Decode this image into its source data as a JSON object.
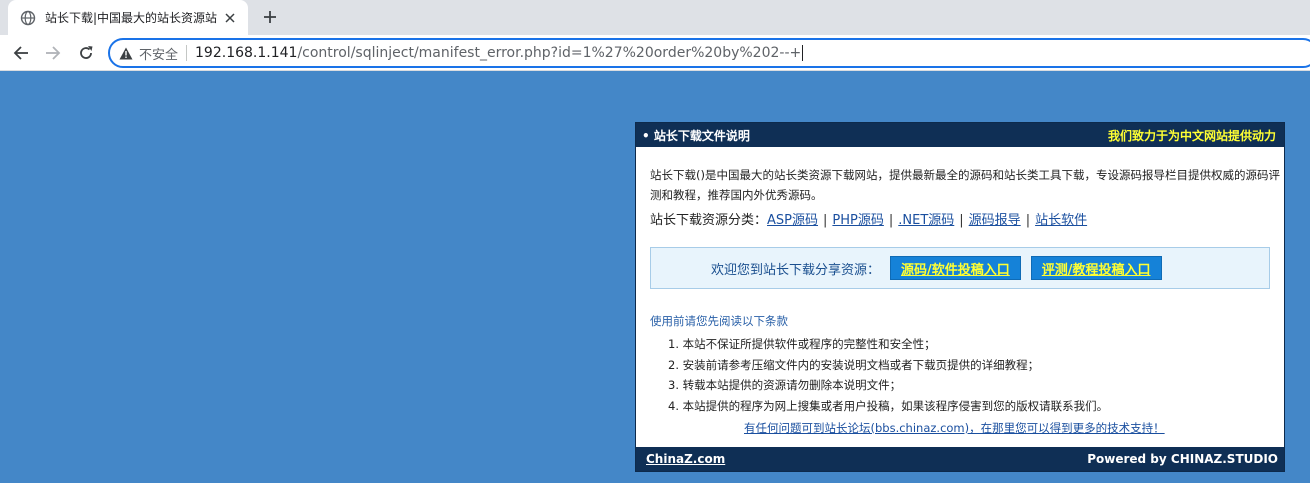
{
  "browser": {
    "tab": {
      "title": "站长下载|中国最大的站长资源站"
    },
    "address_bar": {
      "security_label": "不安全",
      "url_host": "192.168.1.141",
      "url_path": "/control/sqlinject/manifest_error.php?id=1%27%20order%20by%202--+"
    },
    "icons": {
      "favicon": "globe-icon",
      "close": "close-icon",
      "new_tab": "plus-icon",
      "back": "arrow-left-icon",
      "forward": "arrow-right-icon",
      "reload": "reload-icon",
      "security": "warning-icon"
    }
  },
  "panel": {
    "title": "• 站长下载文件说明",
    "slogan": "我们致力于为中文网站提供动力",
    "intro": "站长下载()是中国最大的站长类资源下载网站，提供最新最全的源码和站长类工具下载，专设源码报导栏目提供权威的源码评测和教程，推荐国内外优秀源码。",
    "categories_label": "站长下载资源分类：",
    "categories": [
      "ASP源码",
      "PHP源码",
      ".NET源码",
      "源码报导",
      "站长软件"
    ],
    "share": {
      "text": "欢迎您到站长下载分享资源：",
      "button1": "源码/软件投稿入口",
      "button2": "评测/教程投稿入口"
    },
    "terms_title": "使用前请您先阅读以下条款",
    "terms": [
      "1. 本站不保证所提供软件或程序的完整性和安全性；",
      "2. 安装前请参考压缩文件内的安装说明文档或者下载页提供的详细教程；",
      "3. 转载本站提供的资源请勿删除本说明文件；",
      "4. 本站提供的程序为网上搜集或者用户投稿，如果该程序侵害到您的版权请联系我们。"
    ],
    "support_link": "有任何问题可到站长论坛(bbs.chinaz.com)，在那里您可以得到更多的技术支持！",
    "footer_link": "ChinaZ.com",
    "footer_powered": "Powered by CHINAZ.STUDIO"
  },
  "colors": {
    "page_background": "#4487c8",
    "panel_header": "#0f2f55",
    "slogan": "#ffff33",
    "button_bg": "#1582d8"
  }
}
